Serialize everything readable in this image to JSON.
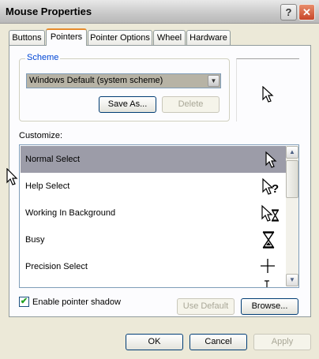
{
  "window": {
    "title": "Mouse Properties",
    "help_glyph": "?",
    "close_glyph": "✕"
  },
  "tabs": [
    {
      "label": "Buttons"
    },
    {
      "label": "Pointers",
      "active": true
    },
    {
      "label": "Pointer Options"
    },
    {
      "label": "Wheel"
    },
    {
      "label": "Hardware"
    }
  ],
  "scheme": {
    "group_label": "Scheme",
    "selected": "Windows Default (system scheme)",
    "save_as_label": "Save As...",
    "delete_label": "Delete"
  },
  "customize": {
    "label": "Customize:",
    "items": [
      {
        "label": "Normal Select",
        "icon": "arrow-cursor-icon",
        "selected": true
      },
      {
        "label": "Help Select",
        "icon": "help-cursor-icon"
      },
      {
        "label": "Working In Background",
        "icon": "busy-background-cursor-icon"
      },
      {
        "label": "Busy",
        "icon": "hourglass-cursor-icon"
      },
      {
        "label": "Precision Select",
        "icon": "crosshair-cursor-icon"
      }
    ]
  },
  "shadow": {
    "label": "Enable pointer shadow",
    "checked": true
  },
  "buttons": {
    "use_default": "Use Default",
    "browse": "Browse...",
    "ok": "OK",
    "cancel": "Cancel",
    "apply": "Apply"
  }
}
